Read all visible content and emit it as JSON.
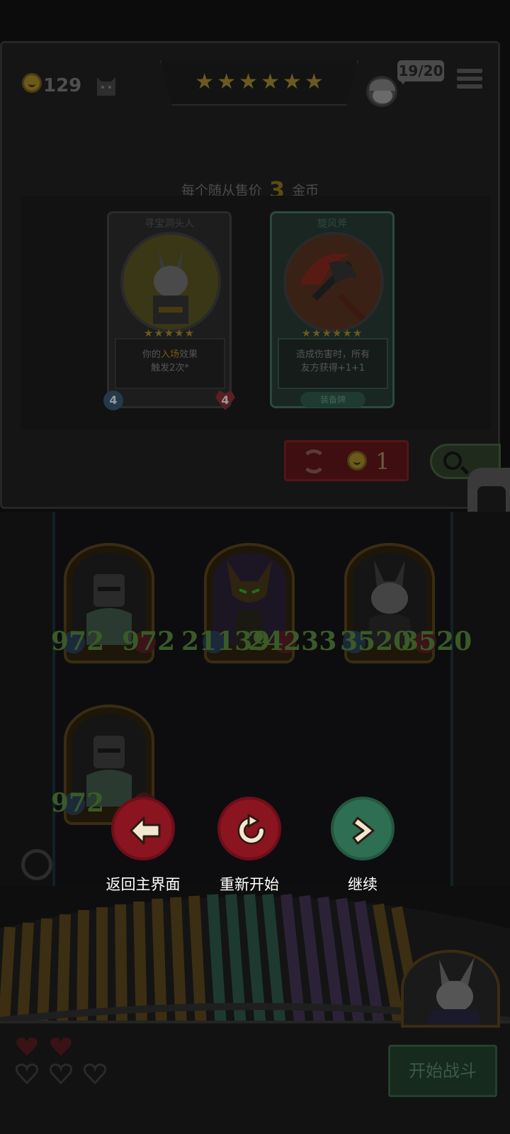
{
  "top_bar": {
    "gold": "129",
    "stars": [
      "★",
      "★",
      "★",
      "★",
      "★",
      "★"
    ],
    "minion_count": "19/20"
  },
  "shop": {
    "sell_prefix": "每个随从售价",
    "sell_amount": "3",
    "sell_suffix": "金币",
    "cards": [
      {
        "title": "寻宝洞头人",
        "stars": "★★★★★",
        "desc_line1_pre": "你的",
        "desc_line1_highlight": "入场",
        "desc_line1_post": "效果",
        "desc_line2": "触发2次*",
        "attack": "4",
        "health": "4"
      },
      {
        "title": "旋风斧",
        "stars": "★★★★★★",
        "desc_line1": "造成伤害时，所有",
        "desc_line2": "友方获得+1+1",
        "tag": "装备牌"
      }
    ],
    "refresh_cost": "1"
  },
  "board": {
    "minions": [
      {
        "atk": "972",
        "hp": "972"
      },
      {
        "atk": "21139",
        "hp": "24233"
      },
      {
        "atk": "3520",
        "hp": "3520"
      },
      {
        "atk": "972",
        "hp": ""
      }
    ]
  },
  "overlay": {
    "back_label": "返回主界面",
    "restart_label": "重新开始",
    "continue_label": "继续"
  },
  "bottom": {
    "start_battle": "开始战斗"
  },
  "colors": {
    "overlay_dim": "#0c0c0c",
    "button_red": "#8a1420",
    "button_green": "#2e6e52",
    "stat_green": "#3a5a28"
  }
}
